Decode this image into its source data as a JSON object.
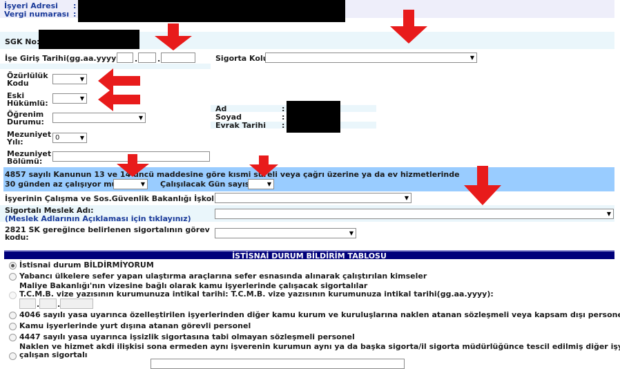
{
  "employer": {
    "address_label": "İşyeri Adresi",
    "address_colon": ":",
    "tax_label": "Vergi numarası",
    "tax_colon": ":"
  },
  "form": {
    "sgk_label": "SGK No:",
    "hire_date_label": "İşe Giriş Tarihi(gg.aa.yyyy):",
    "hire_date_sep": ".",
    "insurance_branch_label": "Sigorta Kolu:",
    "disability_label": "Özürlülük Kodu",
    "ex_convict_label": "Eski Hükümlü:",
    "education_label": "Öğrenim Durumu:",
    "grad_year_label": "Mezuniyet Yılı:",
    "grad_year_value": "0",
    "grad_dept_label": "Mezuniyet Bölümü:",
    "person": {
      "ad_label": "Ad",
      "soyad_label": "Soyad",
      "evrak_label": "Evrak Tarihi",
      "colon": ":"
    },
    "parttime_text": "4857 sayılı Kanunun 13 ve 14 üncü maddesine göre kısmi süreli veya çağrı üzerine ya da ev hizmetlerinde",
    "parttime_q": "30 günden az çalışıyor mu?",
    "work_days_label": "Çalışılacak Gün sayısı:",
    "ministry_label": "İşyerinin Çalışma ve Sos.Güvenlik Bakanlığı İşkolu",
    "occupation_label": "Sigortalı Meslek Adı:",
    "occupation_link": "(Meslek Adlarının Açıklaması için tıklayınız)",
    "duty_label": "2821 SK gereğince belirlenen sigortalının görev kodu:"
  },
  "exception": {
    "header": "İSTİSNAİ DURUM BİLDİRİM TABLOSU",
    "options": [
      "İstisnai durum BİLDİRMİYORUM",
      "Yabancı ülkelere sefer yapan ulaştırma araçlarına sefer esnasında alınarak çalıştırılan kimseler",
      "Maliye Bakanlığı'nın vizesine bağlı olarak kamu işyerlerinde çalışacak sigortalılar",
      "T.C.M.B. vize yazısının kurumunuza intikal tarihi: T.C.M.B. vize yazısının kurumunuza intikal tarihi(gg.aa.yyyy):",
      "4046 sayılı yasa uyarınca özelleştirilen işyerlerinden diğer kamu kurum ve kuruluşlarına naklen atanan sözleşmeli veya kapsam dışı personel",
      "Kamu işyerlerinde yurt dışına atanan görevli personel",
      "4447 sayılı yasa uyarınca işsizlik sigortasına tabi olmayan sözleşmeli personel",
      "Naklen ve hizmet akdi ilişkisi sona ermeden aynı işverenin kurumun aynı ya da başka sigorta/il sigorta müdürlüğünce tescil edilmiş diğer işyerinde",
      "çalışan sigortalı"
    ]
  },
  "colors": {
    "band": "#eaf6fb",
    "section_blue": "#99ccff",
    "header_navy": "#00007a",
    "arrow_red": "#e81b1b",
    "link_blue": "#1a3a9a"
  }
}
